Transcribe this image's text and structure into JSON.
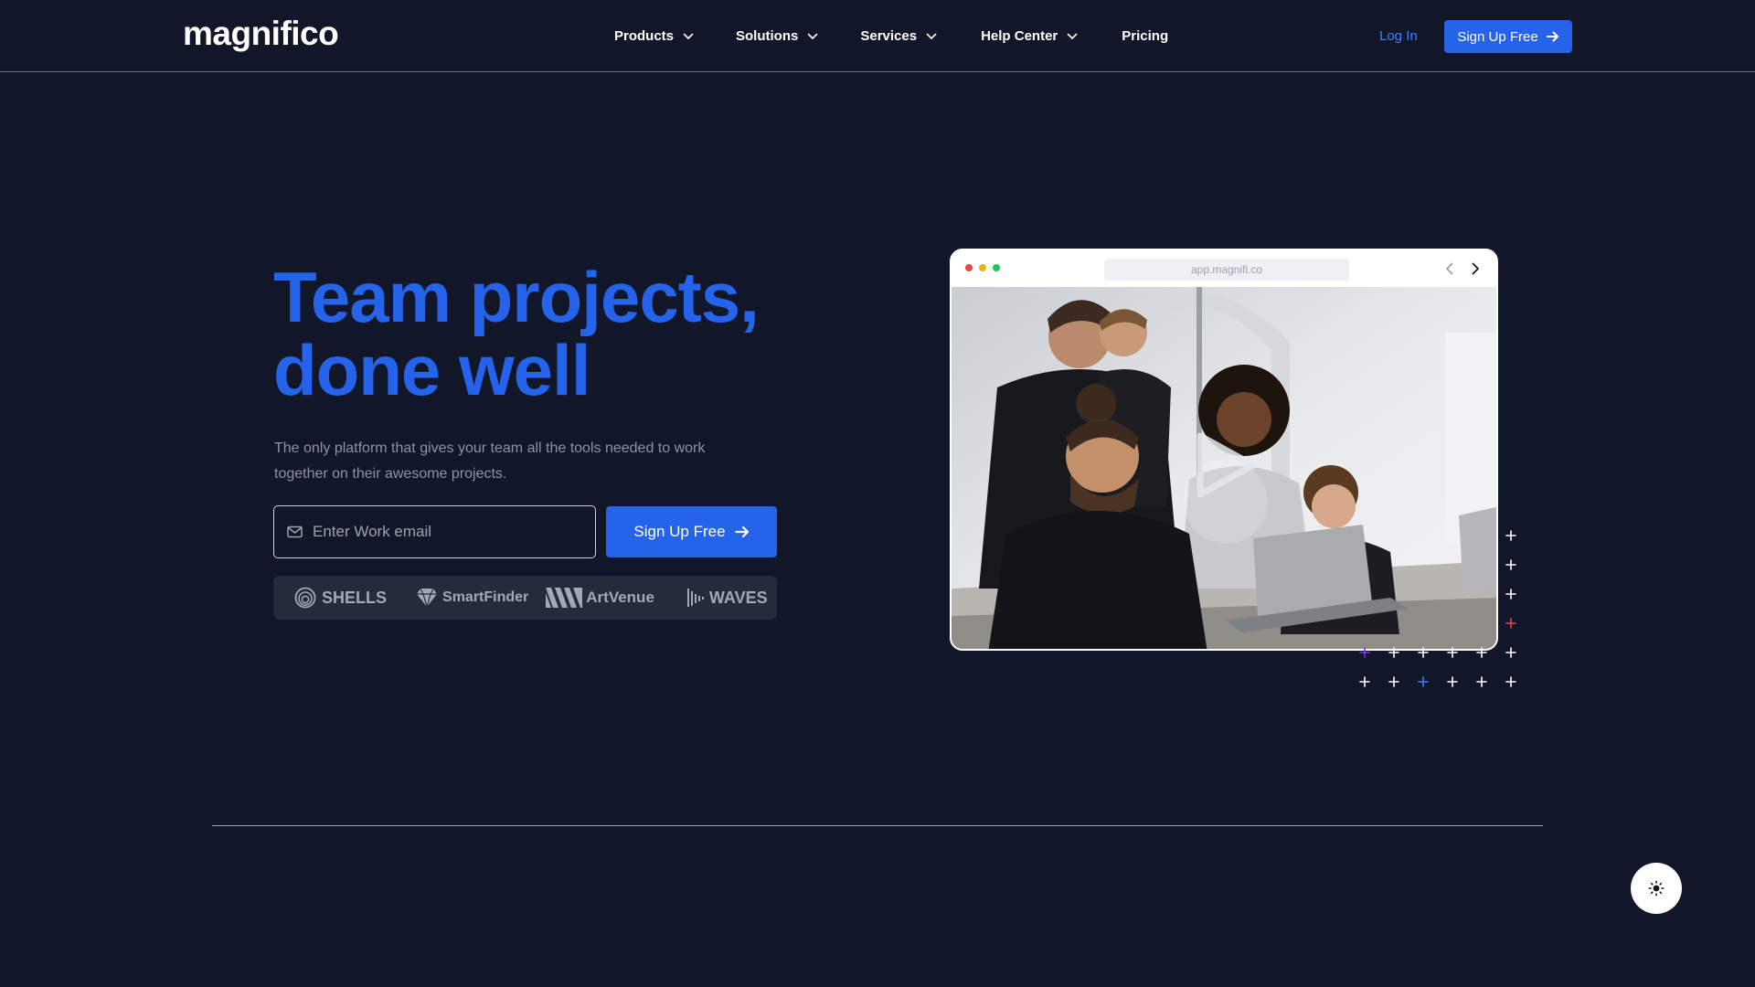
{
  "header": {
    "logo": "magnifico",
    "nav": [
      {
        "label": "Products",
        "icon": "chevron-down-icon"
      },
      {
        "label": "Solutions",
        "icon": "chevron-down-icon"
      },
      {
        "label": "Services",
        "icon": "chevron-down-icon"
      },
      {
        "label": "Help Center",
        "icon": "chevron-down-icon"
      },
      {
        "label": "Pricing"
      }
    ],
    "login_label": "Log In",
    "signup_label": "Sign Up Free"
  },
  "hero": {
    "title_line1": "Team projects,",
    "title_line2": "done well",
    "subtitle": "The only platform that gives your team all the tools needed to work together on their awesome projects.",
    "email_placeholder": "Enter Work email",
    "email_value": "",
    "signup_label": "Sign Up Free"
  },
  "partners": [
    "SHELLS",
    "SmartFinder",
    "ArtVenue",
    "WAVES"
  ],
  "browser_mockup": {
    "url": "app.magnifi.co"
  },
  "icons": {
    "theme_toggle": "sun-icon",
    "signup_arrow": "arrow-right-icon",
    "email": "mail-icon",
    "video": "play-icon"
  },
  "colors": {
    "background": "#111729",
    "accent": "#2563eb",
    "link": "#3b82f6",
    "muted_text": "#8b93a7",
    "partner_bar": "#252b3b"
  }
}
